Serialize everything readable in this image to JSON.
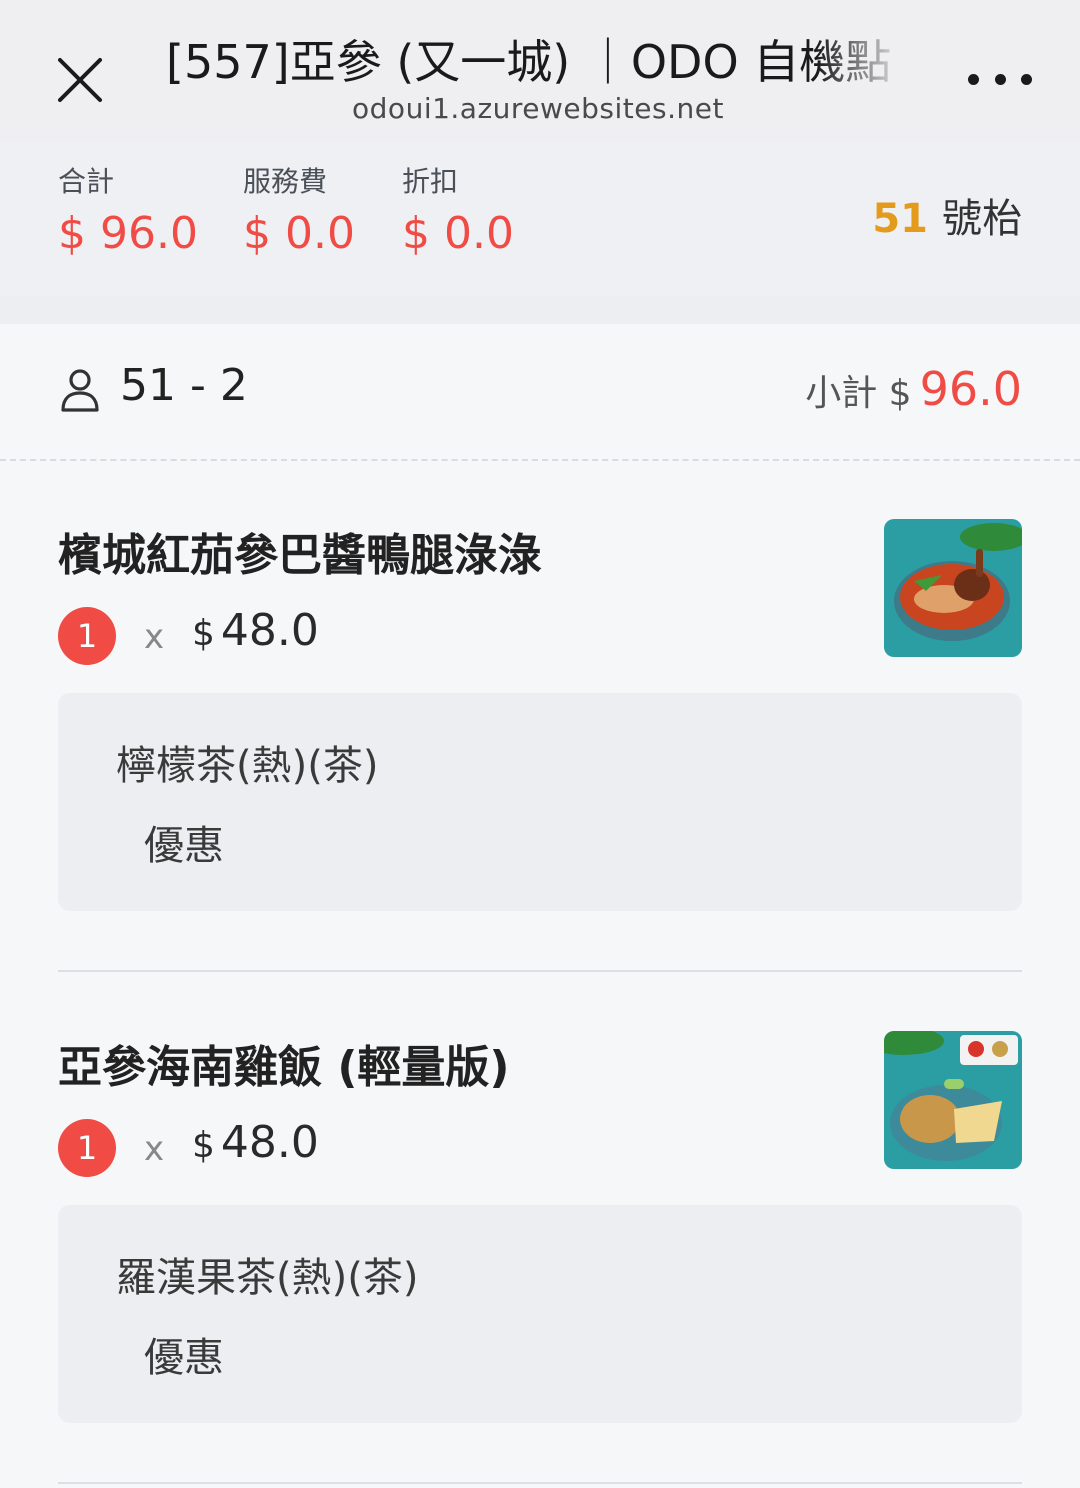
{
  "header": {
    "title": "[557]亞參 (又一城) ｜ODO 自機點",
    "url": "odoui1.azurewebsites.net"
  },
  "summary": {
    "total_label": "合計",
    "total_value": "$ 96.0",
    "service_label": "服務費",
    "service_value": "$ 0.0",
    "discount_label": "折扣",
    "discount_value": "$ 0.0",
    "table_number": "51",
    "table_suffix": "號枱"
  },
  "person": {
    "label": "51 - 2",
    "subtotal_label": "小計 $",
    "subtotal_value": "96.0"
  },
  "items": [
    {
      "name": "檳城紅茄參巴醬鴨腿淥淥",
      "qty": "1",
      "times": "x",
      "currency": "$",
      "price": "48.0",
      "option": "檸檬茶(熱)(茶)",
      "option_sub": "優惠"
    },
    {
      "name": "亞參海南雞飯 (輕量版)",
      "qty": "1",
      "times": "x",
      "currency": "$",
      "price": "48.0",
      "option": "羅漢果茶(熱)(茶)",
      "option_sub": "優惠"
    }
  ],
  "colors": {
    "accent_red": "#f04b44",
    "table_orange": "#e49a1a"
  }
}
